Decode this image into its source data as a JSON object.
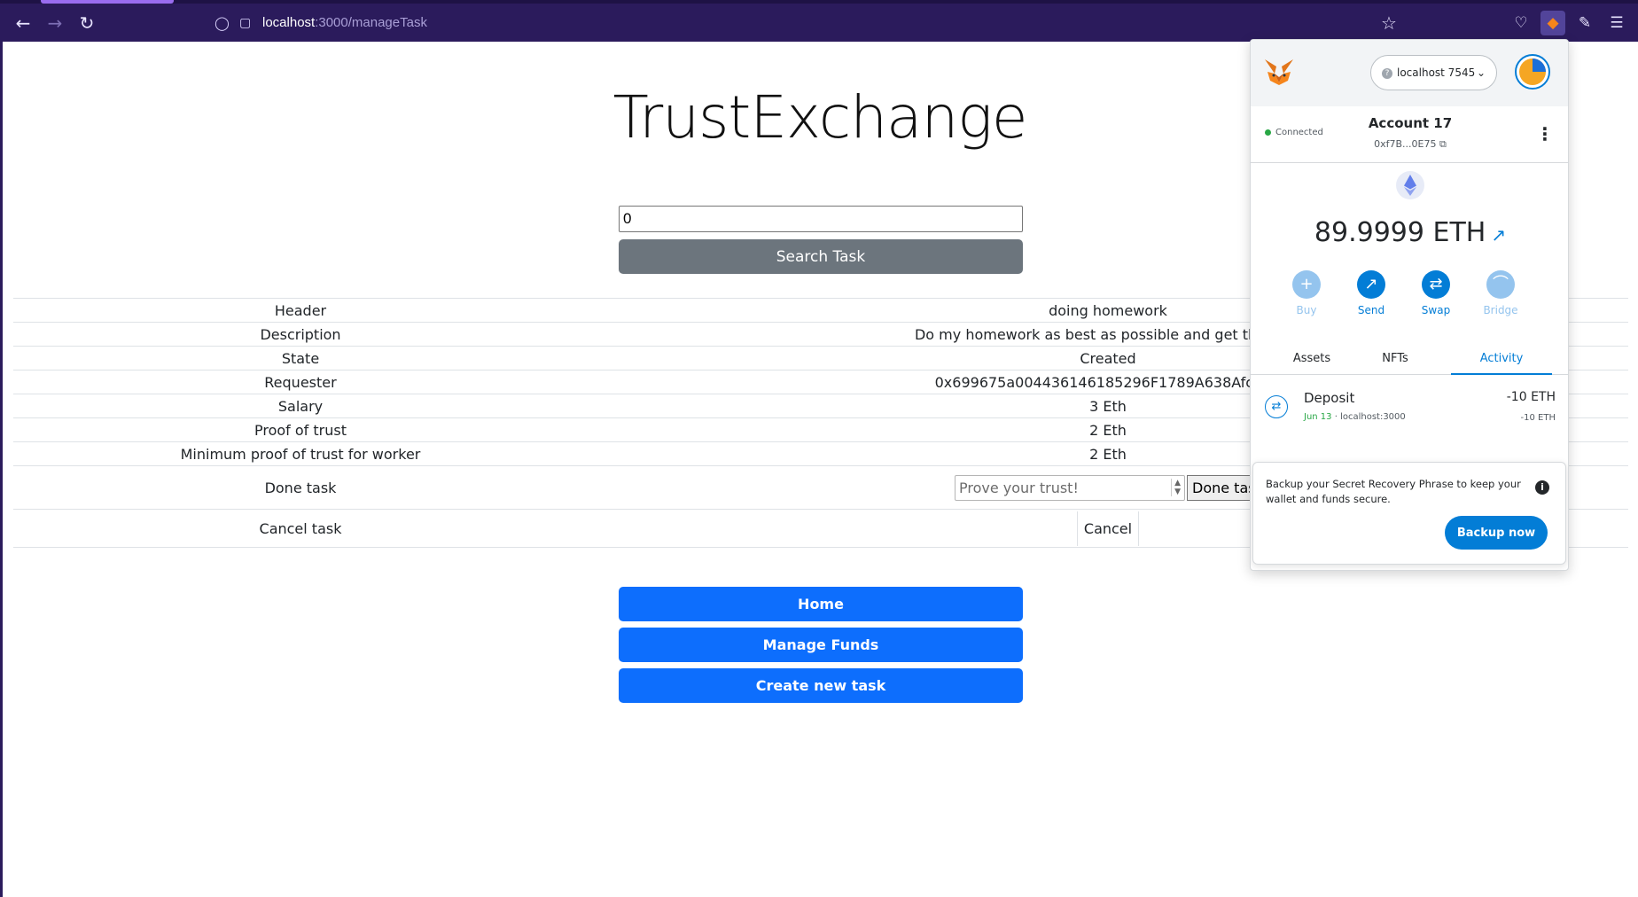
{
  "browser": {
    "url_host": "localhost",
    "url_path": ":3000/manageTask",
    "icons": [
      "back-arrow-icon",
      "forward-arrow-icon",
      "reload-icon",
      "shield-icon",
      "page-icon",
      "star-icon",
      "pocket-icon",
      "metamask-fox-icon",
      "extensions-icon",
      "menu-icon"
    ]
  },
  "app": {
    "title": "TrustExchange",
    "search": {
      "value": "0",
      "button_label": "Search Task"
    },
    "task_rows": [
      {
        "label": "Header",
        "value": "doing homework"
      },
      {
        "label": "Description",
        "value": "Do my homework as best as possible and get the high"
      },
      {
        "label": "State",
        "value": "Created"
      },
      {
        "label": "Requester",
        "value": "0x699675a004436146185296F1789A638Afc98A"
      },
      {
        "label": "Salary",
        "value": "3 Eth"
      },
      {
        "label": "Proof of trust",
        "value": "2 Eth"
      },
      {
        "label": "Minimum proof of trust for worker",
        "value": "2 Eth"
      }
    ],
    "done_task": {
      "label": "Done task",
      "placeholder": "Prove your trust!",
      "button_label": "Done task"
    },
    "cancel_task": {
      "label": "Cancel task",
      "button_label": "Cancel"
    },
    "nav_buttons": {
      "home": "Home",
      "manage_funds": "Manage Funds",
      "create_task": "Create new task"
    }
  },
  "metamask": {
    "network": "localhost 7545",
    "connection_status": "Connected",
    "account_name": "Account 17",
    "account_address": "0xf7B...0E75",
    "balance": "89.9999 ETH",
    "actions": {
      "buy": "Buy",
      "send": "Send",
      "swap": "Swap",
      "bridge": "Bridge"
    },
    "tabs": {
      "assets": "Assets",
      "nfts": "NFTs",
      "activity": "Activity"
    },
    "activity": {
      "title": "Deposit",
      "date": "Jun 13",
      "origin": " · localhost:3000",
      "amount": "-10 ETH",
      "amount_secondary": "-10 ETH"
    },
    "backup": {
      "text": "Backup your Secret Recovery Phrase to keep your wallet and funds secure.",
      "button_label": "Backup now"
    },
    "colors": {
      "accent": "#037dd6",
      "connected": "#28a745"
    }
  },
  "colors": {
    "browser_chrome": "#2b1b5c",
    "primary_button": "#0d6efd",
    "secondary_button": "#6c757d"
  }
}
